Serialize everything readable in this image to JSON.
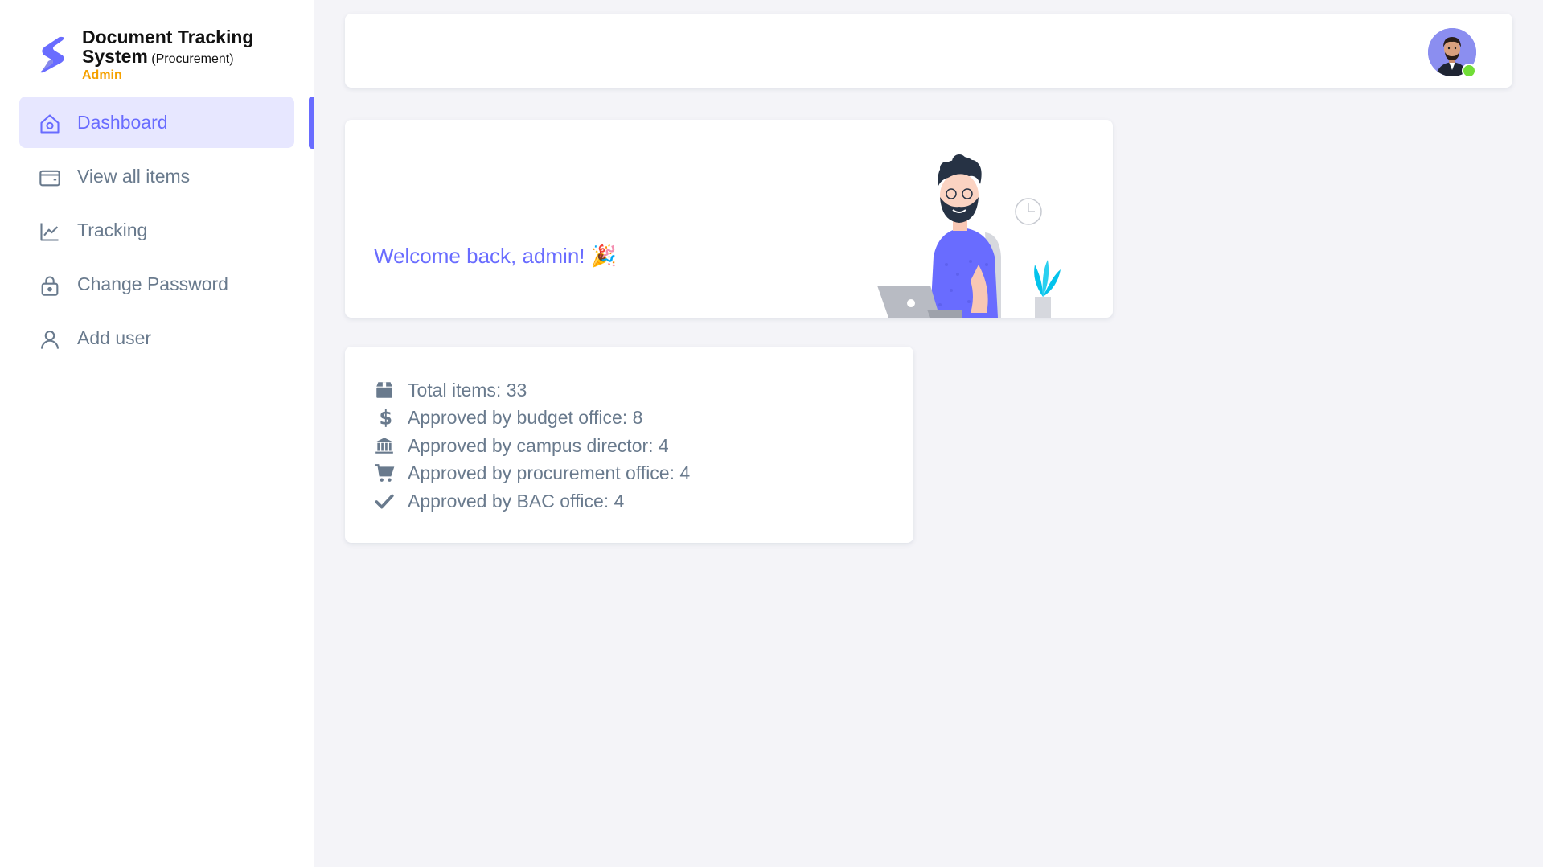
{
  "brand": {
    "title_line1": "Document Tracking",
    "title_line2": "System",
    "subtitle": "(Procurement)",
    "role": "Admin",
    "logo_color": "#696cff"
  },
  "menu": {
    "items": [
      {
        "label": "Dashboard",
        "icon": "home-icon",
        "active": true
      },
      {
        "label": "View all items",
        "icon": "wallet-icon",
        "active": false
      },
      {
        "label": "Tracking",
        "icon": "line-chart-icon",
        "active": false
      },
      {
        "label": "Change Password",
        "icon": "lock-icon",
        "active": false
      },
      {
        "label": "Add user",
        "icon": "user-icon",
        "active": false
      }
    ]
  },
  "navbar": {
    "avatar_icon": "user-avatar",
    "status": "online",
    "status_color": "#71dd37"
  },
  "welcome": {
    "message": "Welcome back, admin! 🎉",
    "accent": "#696cff"
  },
  "stats": [
    {
      "icon": "box-icon",
      "label": "Total items: 33"
    },
    {
      "icon": "dollar-icon",
      "label": "Approved by budget office: 8"
    },
    {
      "icon": "bank-icon",
      "label": "Approved by campus director: 4"
    },
    {
      "icon": "cart-icon",
      "label": "Approved by procurement office: 4"
    },
    {
      "icon": "check-icon",
      "label": "Approved by BAC office: 4"
    }
  ]
}
